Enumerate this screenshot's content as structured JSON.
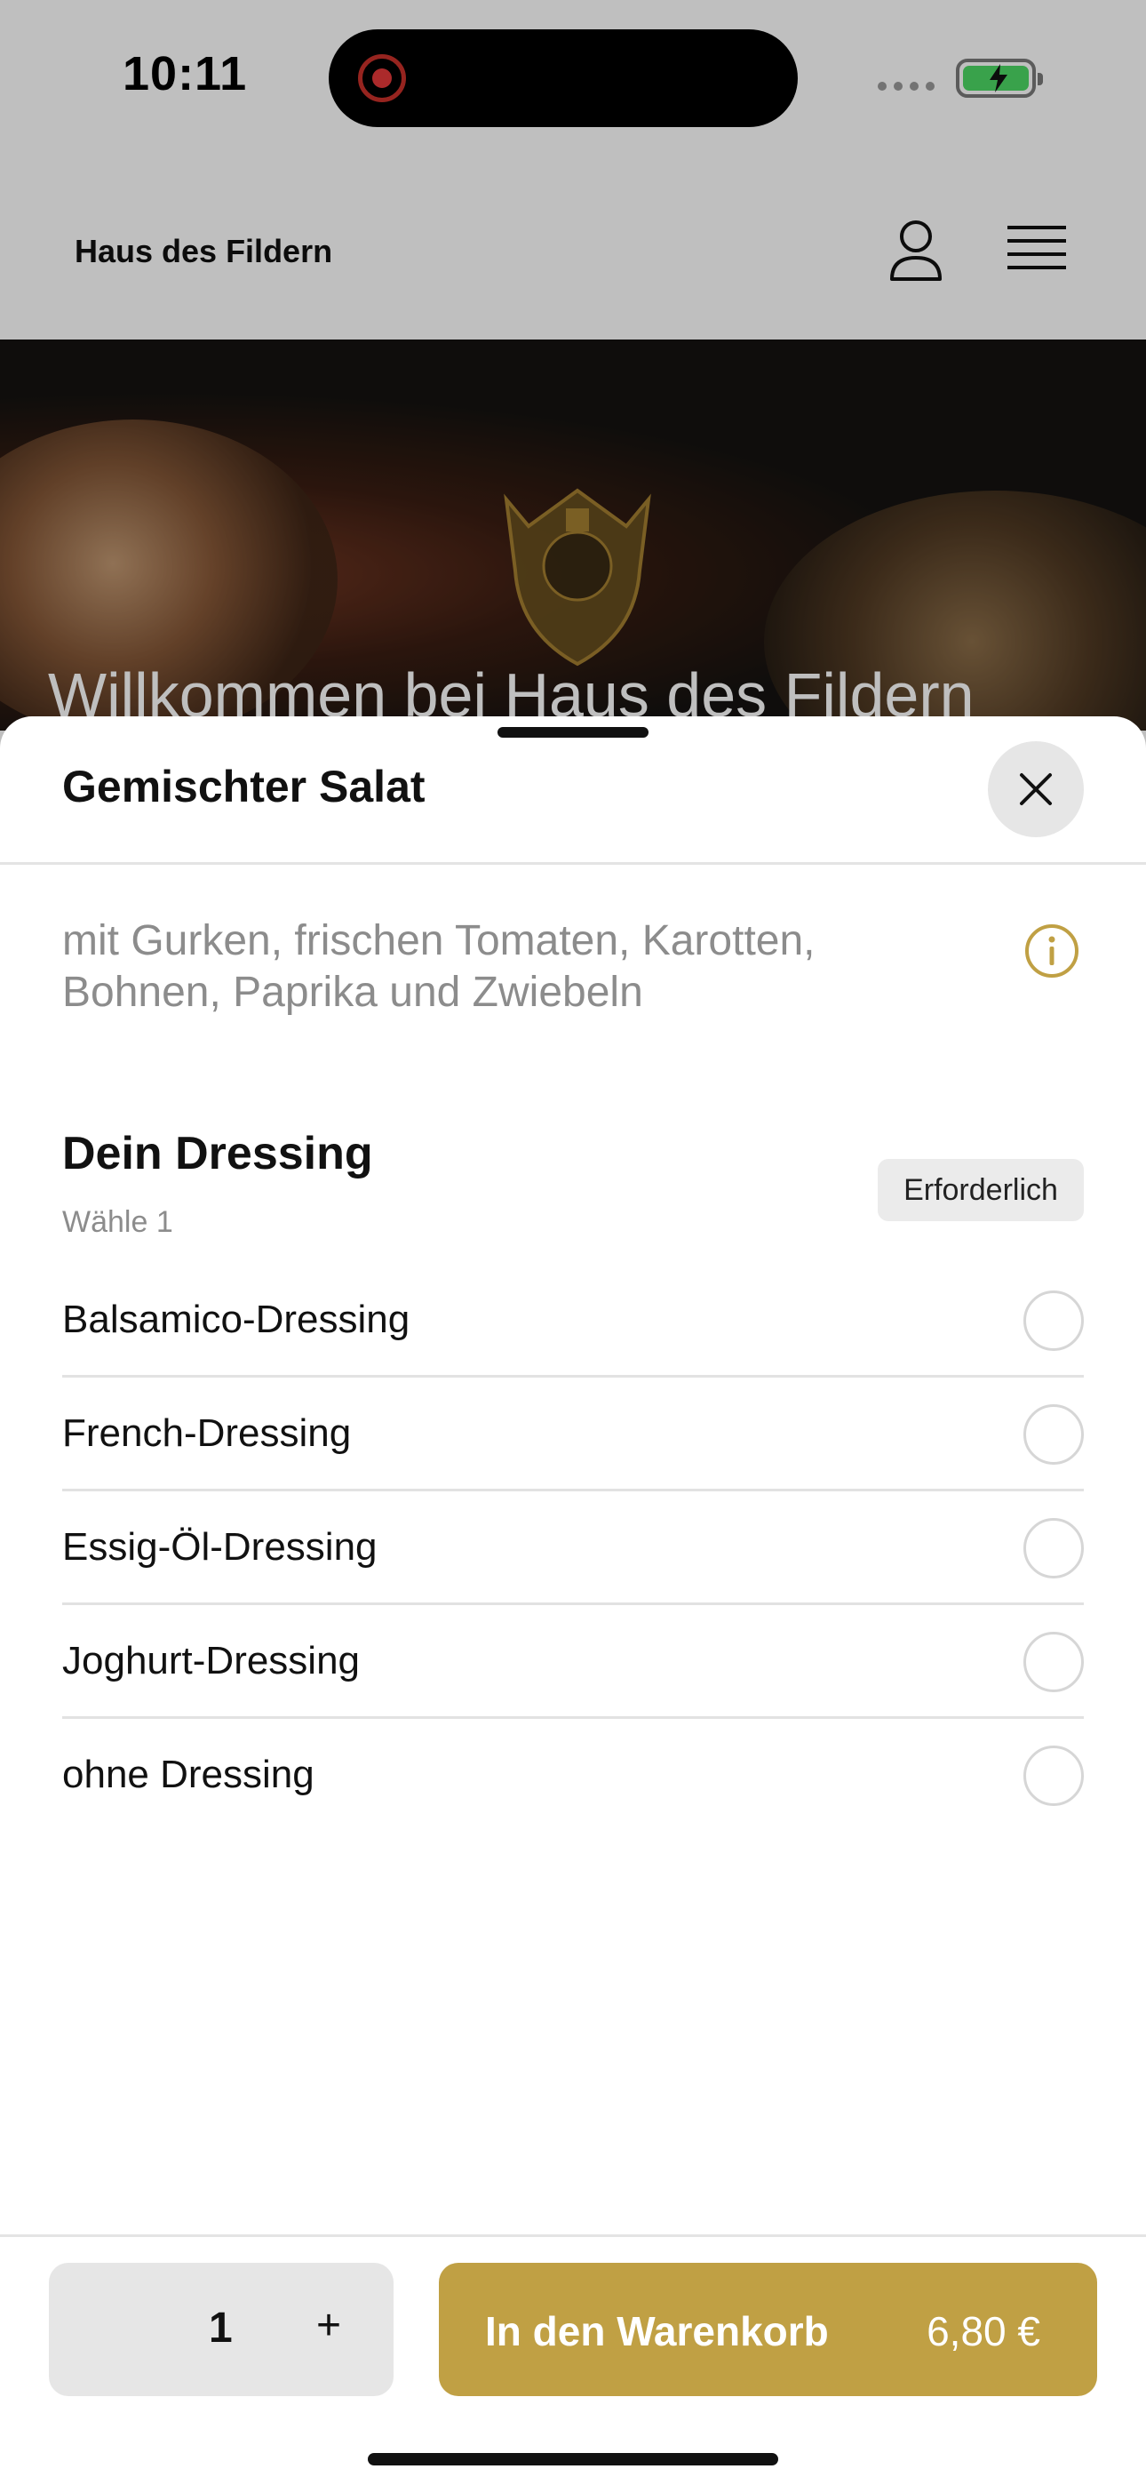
{
  "status_bar": {
    "time": "10:11"
  },
  "header": {
    "site_title": "Haus des Fildern"
  },
  "hero": {
    "welcome_text": "Willkommen bei Haus des Fildern"
  },
  "sheet": {
    "title": "Gemischter Salat",
    "description": "mit Gurken, frischen Tomaten, Karotten, Bohnen, Paprika und Zwiebeln",
    "group": {
      "title": "Dein Dressing",
      "subtitle": "Wähle 1",
      "badge": "Erforderlich",
      "options": [
        {
          "label": "Balsamico-Dressing",
          "selected": false
        },
        {
          "label": "French-Dressing",
          "selected": false
        },
        {
          "label": "Essig-Öl-Dressing",
          "selected": false
        },
        {
          "label": "Joghurt-Dressing",
          "selected": false
        },
        {
          "label": "ohne Dressing",
          "selected": false
        }
      ]
    },
    "footer": {
      "quantity": "1",
      "plus": "+",
      "cart_label": "In den Warenkorb",
      "price": "6,80 €"
    }
  },
  "colors": {
    "accent": "#c0a044",
    "badge_bg": "#ebebeb",
    "dim_overlay": "rgba(0,0,0,0.25)"
  },
  "icons": [
    "record-icon",
    "battery-charging-icon",
    "user-icon",
    "menu-icon",
    "close-icon",
    "info-icon"
  ]
}
